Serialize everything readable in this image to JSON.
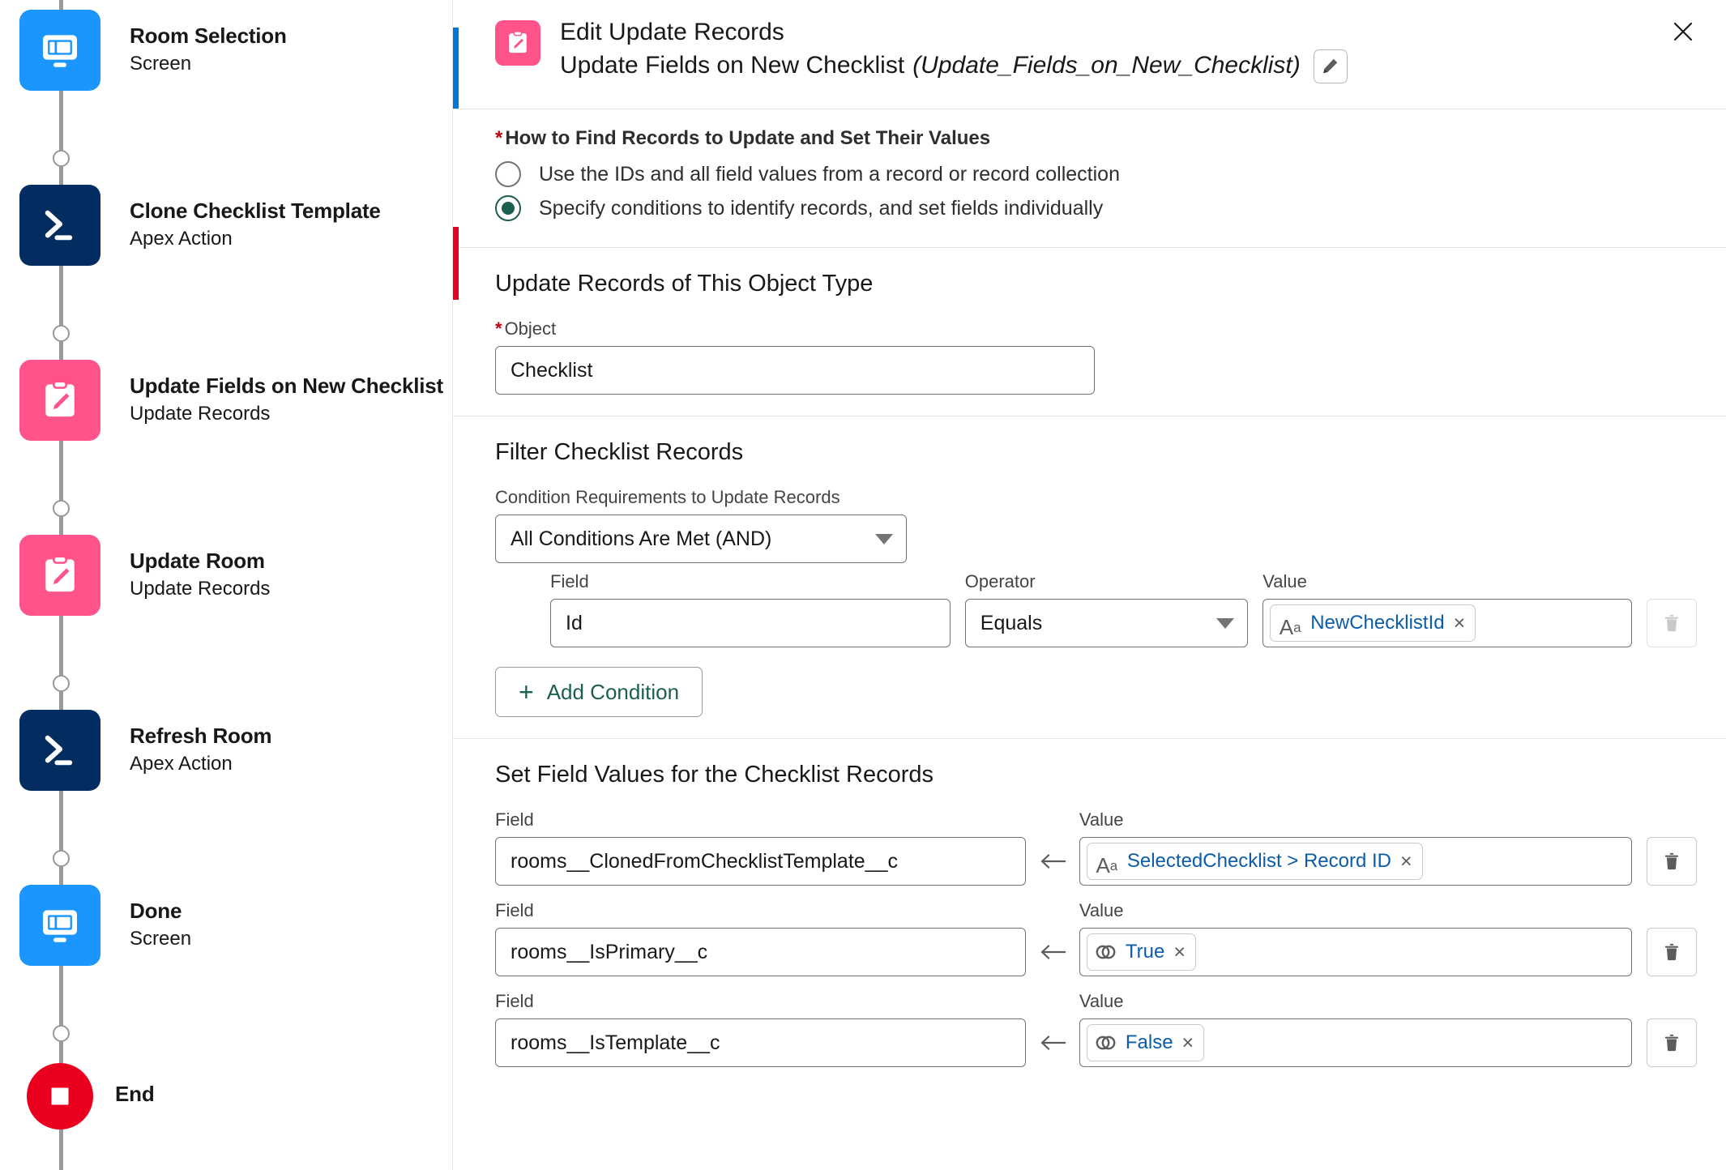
{
  "flow_canvas": {
    "nodes": [
      {
        "title": "Room Selection",
        "subtitle": "Screen",
        "icon": "screen-icon",
        "type": "screen"
      },
      {
        "title": "Clone Checklist Template",
        "subtitle": "Apex Action",
        "icon": "apex-action-icon",
        "type": "apex"
      },
      {
        "title": "Update Fields on New Checklist",
        "subtitle": "Update Records",
        "icon": "update-records-icon",
        "type": "update"
      },
      {
        "title": "Update Room",
        "subtitle": "Update Records",
        "icon": "update-records-icon",
        "type": "update"
      },
      {
        "title": "Refresh Room",
        "subtitle": "Apex Action",
        "icon": "apex-action-icon",
        "type": "apex"
      },
      {
        "title": "Done",
        "subtitle": "Screen",
        "icon": "screen-icon",
        "type": "screen"
      },
      {
        "title": "End",
        "subtitle": "",
        "icon": "end-icon",
        "type": "end"
      }
    ],
    "colors": {
      "screen": "#1b96ff",
      "apex": "#032d60",
      "update": "#ff538a",
      "end": "#ea001e",
      "connector": "#9a9a9a"
    }
  },
  "panel": {
    "header": {
      "icon": "update-records-icon",
      "line1": "Edit Update Records",
      "element_label": "Update Fields on New Checklist",
      "api_name": "(Update_Fields_on_New_Checklist)",
      "edit_button": "pencil-icon",
      "close_button": "close-icon"
    },
    "how_to_find": {
      "required_mark": "*",
      "label": "How to Find Records to Update and Set Their Values",
      "options": [
        {
          "label": "Use the IDs and all field values from a record or record collection",
          "selected": false
        },
        {
          "label": "Specify conditions to identify records, and set fields individually",
          "selected": true
        }
      ]
    },
    "object_section": {
      "title": "Update Records of This Object Type",
      "object_label": "Object",
      "object_required_mark": "*",
      "object_value": "Checklist"
    },
    "filter_section": {
      "title": "Filter Checklist Records",
      "condition_requirements_label": "Condition Requirements to Update Records",
      "condition_requirements_value": "All Conditions Are Met (AND)",
      "columns": {
        "field": "Field",
        "operator": "Operator",
        "value": "Value"
      },
      "conditions": [
        {
          "field": "Id",
          "operator": "Equals",
          "value_pill": "NewChecklistId",
          "value_icon": "text-variable-icon",
          "pill_remove": "×",
          "delete_button": "trash-icon",
          "delete_disabled": true
        }
      ],
      "add_condition_label": "Add Condition",
      "add_condition_icon": "plus-icon"
    },
    "set_values_section": {
      "title": "Set Field Values for the Checklist Records",
      "field_label": "Field",
      "value_label": "Value",
      "assignment_icon": "left-arrow-icon",
      "rows": [
        {
          "field": "rooms__ClonedFromChecklistTemplate__c",
          "value_pill": "SelectedChecklist > Record ID",
          "value_icon": "text-variable-icon",
          "pill_remove": "×",
          "delete_button": "trash-icon"
        },
        {
          "field": "rooms__IsPrimary__c",
          "value_pill": "True",
          "value_icon": "boolean-variable-icon",
          "pill_remove": "×",
          "delete_button": "trash-icon"
        },
        {
          "field": "rooms__IsTemplate__c",
          "value_pill": "False",
          "value_icon": "boolean-variable-icon",
          "pill_remove": "×",
          "delete_button": "trash-icon"
        }
      ]
    },
    "colors": {
      "accent_blue": "#0176d3",
      "accent_red": "#ea001e",
      "link_blue": "#0b5cab",
      "action_green": "#1b5f4f",
      "required_red": "#ba0517"
    }
  }
}
